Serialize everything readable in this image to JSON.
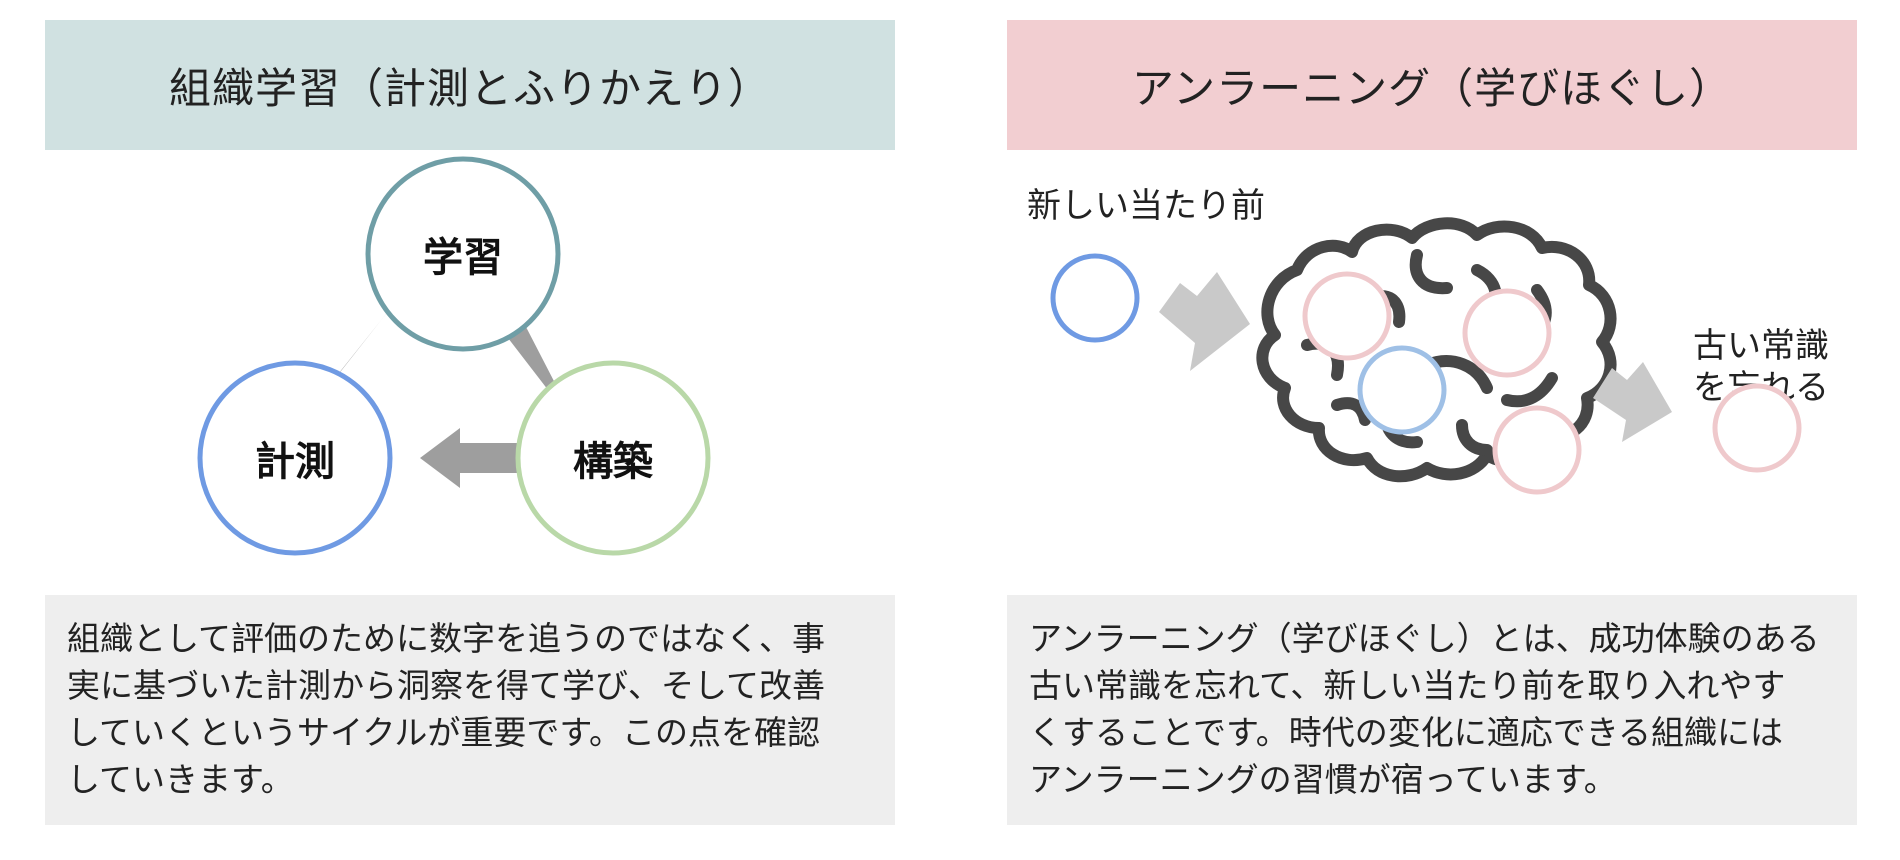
{
  "colors": {
    "left_header_bg": "#d0e1e1",
    "right_header_bg": "#f2ced1",
    "desc_bg": "#eeeeee",
    "arrow": "#9e9e9e",
    "circle_learning": "#6f9ea6",
    "circle_measure": "#6f9ae3",
    "circle_build": "#b9d8a8",
    "circle_pink": "#efc9cc",
    "circle_blue": "#6f9ae3",
    "circle_lightblue": "#9fc0e6",
    "brain_outline": "#474747"
  },
  "left": {
    "header": "組織学習（計測とふりかえり）",
    "nodes": {
      "learning": "学習",
      "measure": "計測",
      "build": "構築"
    },
    "description_lines": [
      "組織として評価のために数字を追うのではなく、事",
      "実に基づいた計測から洞察を得て学び、そして改善",
      "していくというサイクルが重要です。この点を確認",
      "していきます。"
    ]
  },
  "right": {
    "header": "アンラーニング（学びほぐし）",
    "label_new": "新しい当たり前",
    "label_old_lines": [
      "古い常識",
      "を忘れる"
    ],
    "brain_icon": "brain-icon",
    "description_lines": [
      "アンラーニング（学びほぐし）とは、成功体験のある",
      "古い常識を忘れて、新しい当たり前を取り入れやす",
      "くすることです。時代の変化に適応できる組織には",
      "アンラーニングの習慣が宿っています。"
    ]
  }
}
